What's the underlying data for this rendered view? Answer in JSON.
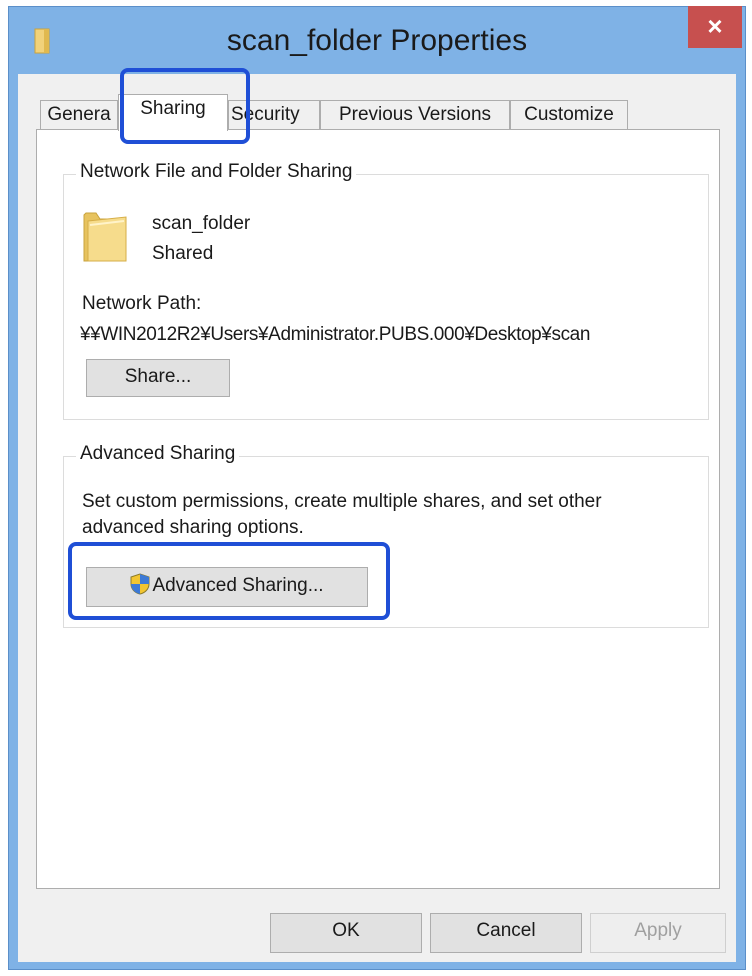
{
  "window": {
    "title": "scan_folder Properties",
    "close_label": "×"
  },
  "tabs": [
    {
      "label": "General",
      "shown": "Genera"
    },
    {
      "label": "Sharing"
    },
    {
      "label": "Security",
      "shown": "Security"
    },
    {
      "label": "Previous Versions"
    },
    {
      "label": "Customize"
    }
  ],
  "active_tab": "Sharing",
  "network_sharing": {
    "group_title": "Network File and Folder Sharing",
    "folder_name": "scan_folder",
    "status": "Shared",
    "path_label": "Network Path:",
    "path_value": "¥¥WIN2012R2¥Users¥Administrator.PUBS.000¥Desktop¥scan",
    "share_button": "Share..."
  },
  "advanced_sharing": {
    "group_title": "Advanced Sharing",
    "description_line1": "Set custom permissions, create multiple shares, and set other",
    "description_line2": "advanced sharing options.",
    "button_label": "Advanced Sharing..."
  },
  "footer": {
    "ok": "OK",
    "cancel": "Cancel",
    "apply": "Apply"
  },
  "colors": {
    "title_bar": "#7fb2e6",
    "close_button": "#c7504f",
    "highlight": "#1f4fd6"
  }
}
